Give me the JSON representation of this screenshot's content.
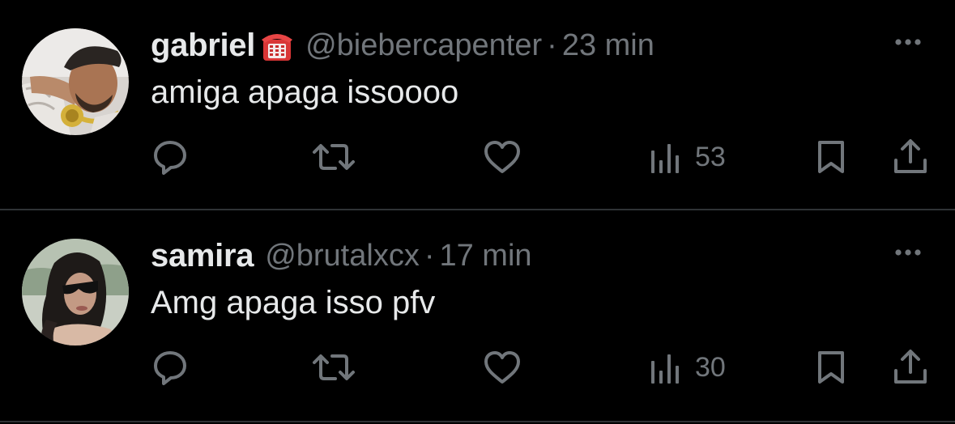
{
  "colors": {
    "background": "#000000",
    "text_primary": "#e7e9ea",
    "text_secondary": "#71767b",
    "divider": "#2f3336",
    "icon": "#71767b"
  },
  "tweets": [
    {
      "display_name": "gabriel",
      "name_emoji": "telephone-emoji",
      "handle": "@biebercapenter",
      "separator": "·",
      "time": "23 min",
      "text": "amiga apaga issoooo",
      "views": "53",
      "icons": [
        "reply-icon",
        "retweet-icon",
        "like-icon",
        "views-icon",
        "bookmark-icon",
        "share-icon",
        "more-icon"
      ]
    },
    {
      "display_name": "samira",
      "handle": "@brutalxcx",
      "separator": "·",
      "time": "17 min",
      "text": "Amg apaga isso pfv",
      "views": "30",
      "icons": [
        "reply-icon",
        "retweet-icon",
        "like-icon",
        "views-icon",
        "bookmark-icon",
        "share-icon",
        "more-icon"
      ]
    }
  ]
}
